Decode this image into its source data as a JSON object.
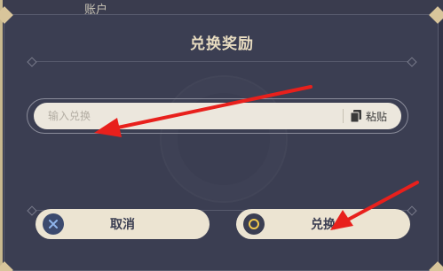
{
  "background": {
    "behind_title": "账户"
  },
  "dialog": {
    "title": "兑换奖励",
    "code_input": {
      "placeholder": "输入兑换",
      "value": ""
    },
    "paste_label": "粘贴",
    "cancel_label": "取消",
    "confirm_label": "兑换"
  },
  "annotations": {
    "arrow_color": "#e8201c"
  },
  "colors": {
    "dialog_bg": "#3b3e52",
    "title": "#e8dcc0",
    "input_bg": "#ece7dd",
    "button_bg": "#ece4d2",
    "gold_accent": "#d8c59b"
  }
}
